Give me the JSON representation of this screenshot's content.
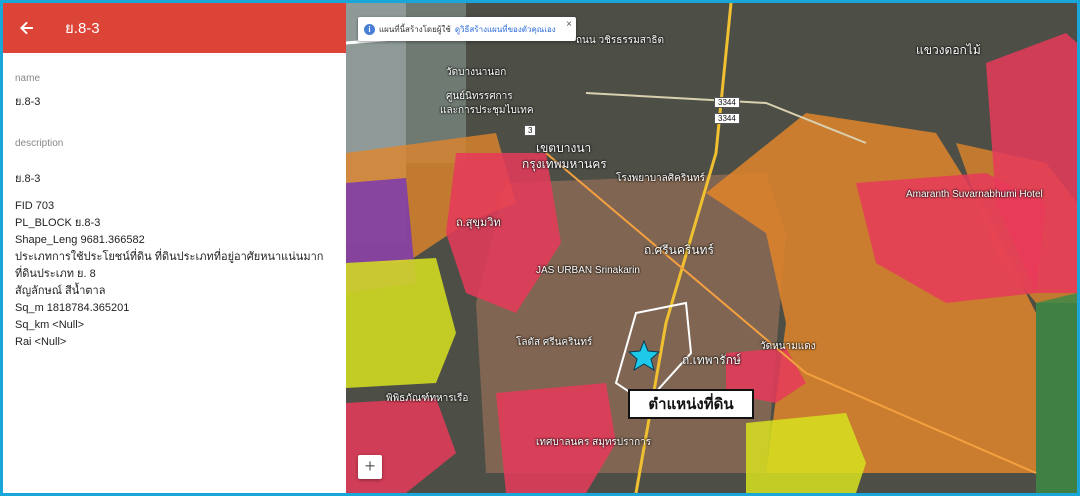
{
  "panel": {
    "title": "ย.8-3",
    "back_icon": "arrow-back-icon",
    "name_label": "name",
    "name_value": "ย.8-3",
    "description_label": "description",
    "description_first": "ย.8-3",
    "description_lines": [
      "FID 703",
      "PL_BLOCK ย.8-3",
      "Shape_Leng 9681.366582",
      "ประเภทการใช้ประโยชน์ที่ดิน ที่ดินประเภทที่อยู่อาศัยหนาแน่นมาก",
      "ที่ดินประเภท ย. 8",
      "สัญลักษณ์ สีน้ำตาล",
      "Sq_m 1818784.365201",
      "Sq_km <Null>",
      "Rai <Null>"
    ]
  },
  "map": {
    "notice_text": "แผนที่นี้สร้างโดยผู้ใช้",
    "notice_link": "ดูวิธีสร้างแผนที่ของตัวคุณเอง",
    "notice_close": "×",
    "zoom_in": "+",
    "callout": "ตำแหน่งที่ดิน",
    "road_badge_1": "3344",
    "road_badge_2": "3344",
    "road_badge_3": "3",
    "labels": {
      "l1": "วัดบางนานอก",
      "l2": "ถนน วชิรธรรมสาธิต",
      "l3": "ศูนย์นิทรรศการ",
      "l4": "และการประชุมไบเทค",
      "l5": "เขตบางนา",
      "l6": "กรุงเทพมหานคร",
      "l7": "โรงพยาบาลศิครินทร์",
      "l8": "JAS URBAN Srinakarin",
      "l9": "ถ.ศรีนครินทร์",
      "l10": "ถ.เทพารักษ์",
      "l11": "โลตัส ศรีนครินทร์",
      "l12": "พิพิธภัณฑ์ทหารเรือ",
      "l13": "แขวงดอกไม้",
      "l14": "Amaranth Suvarnabhumi Hotel",
      "l15": "วัดหนามแดง",
      "l16": "ถ.สุขุมวิท",
      "l17": "เทศบาลนคร สมุทรปราการ"
    },
    "colors": {
      "orange_zone": "#e0852a",
      "red_zone": "#e83a5a",
      "yellow_zone": "#d8e020",
      "brown_zone": "#8a6a55",
      "purple_zone": "#7a3ab0",
      "marker_star": "#1ec8e8"
    }
  }
}
